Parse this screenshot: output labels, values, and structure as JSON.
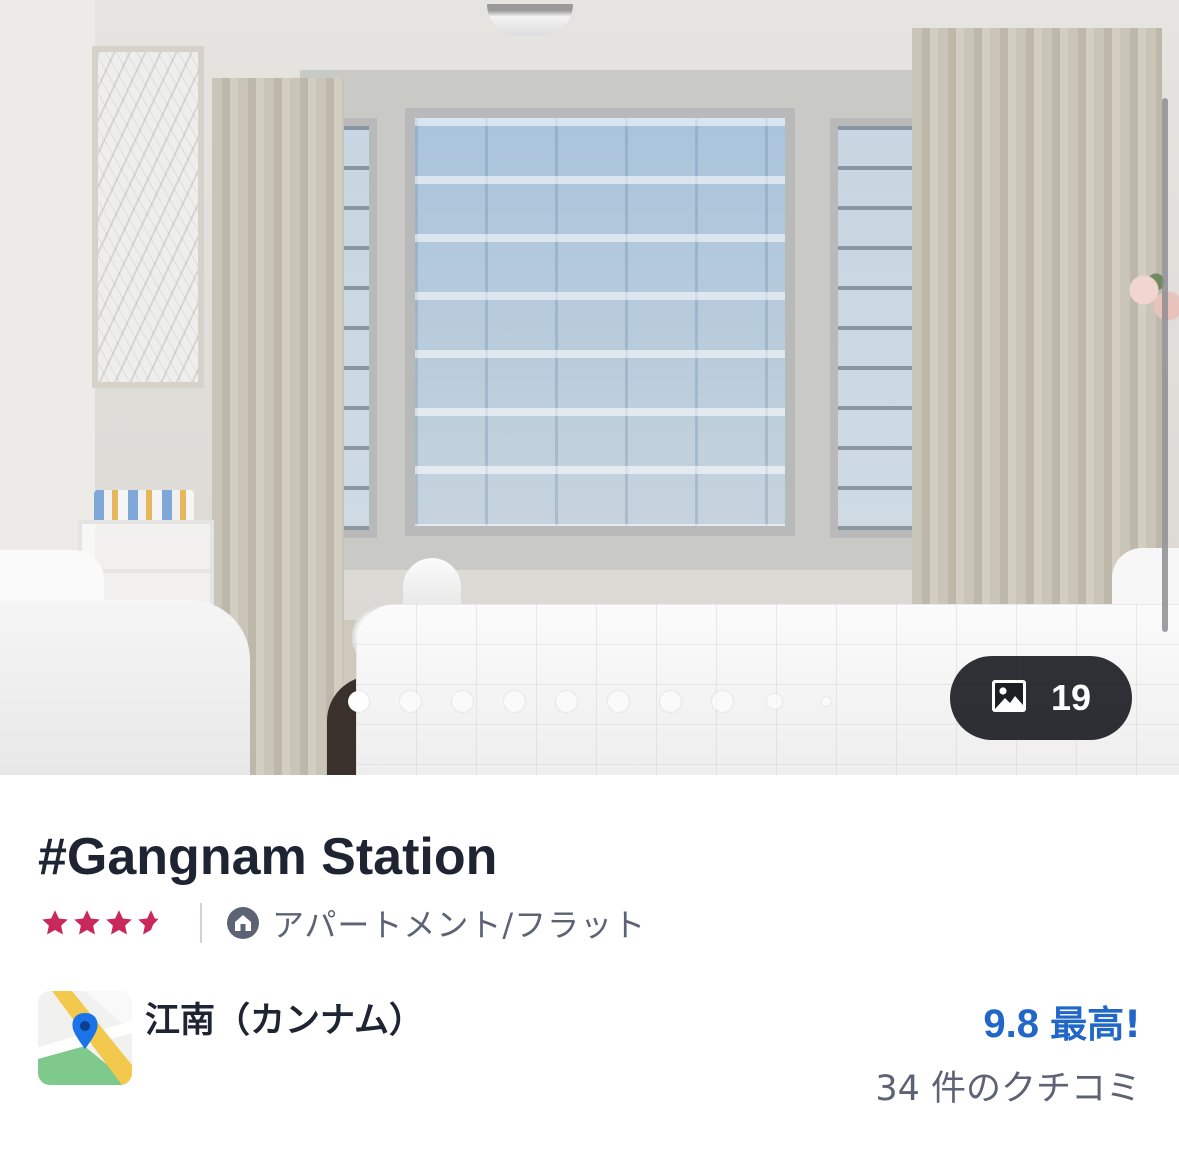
{
  "gallery": {
    "photo_count": "19",
    "photo_icon": "image-icon",
    "dots_total": 10,
    "active_dot": 1
  },
  "listing": {
    "title": "#Gangnam Station",
    "star_rating": 3.5,
    "star_color": "#c8285a",
    "property_type_icon": "home-icon",
    "property_type": "アパートメント/フラット",
    "location_icon": "map-pin-icon",
    "location": "江南（カンナム）"
  },
  "review": {
    "score": "9.8",
    "label": "最高!",
    "count_text": "34 件のクチコミ",
    "accent_color": "#2067c7"
  }
}
